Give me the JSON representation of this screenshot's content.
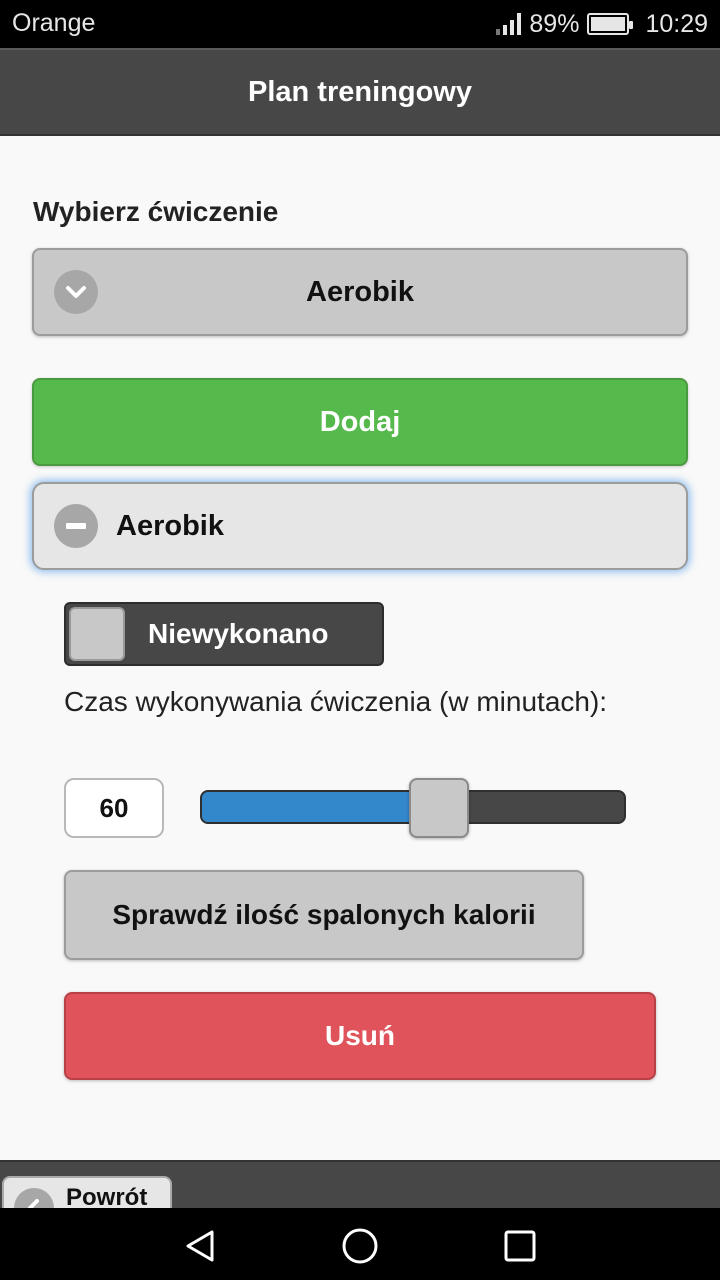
{
  "status_bar": {
    "carrier": "Orange",
    "battery_percent": "89%",
    "time": "10:29",
    "icons": [
      "signal-icon",
      "battery-icon"
    ]
  },
  "header": {
    "title": "Plan treningowy"
  },
  "exercise_select": {
    "label": "Wybierz ćwiczenie",
    "selected": "Aerobik",
    "icon": "chevron-down-icon"
  },
  "add_button": {
    "label": "Dodaj",
    "color": "#56b94b"
  },
  "exercise_item": {
    "title": "Aerobik",
    "icon": "minus-icon",
    "status_toggle": {
      "label": "Niewykonano",
      "checked": false
    },
    "duration": {
      "label": "Czas wykonywania ćwiczenia (w minutach):",
      "value": "60",
      "slider_fraction": 0.56
    },
    "calories_button": "Sprawdź ilość spalonych kalorii",
    "delete_button": {
      "label": "Usuń",
      "color": "#e0535a"
    }
  },
  "footer": {
    "back_button": "Powrót",
    "icon": "chevron-left-icon"
  },
  "nav_bar": {
    "icons": [
      "back-triangle-icon",
      "home-circle-icon",
      "recents-square-icon"
    ]
  },
  "colors": {
    "accent": "#3388cc",
    "header": "#474747"
  }
}
